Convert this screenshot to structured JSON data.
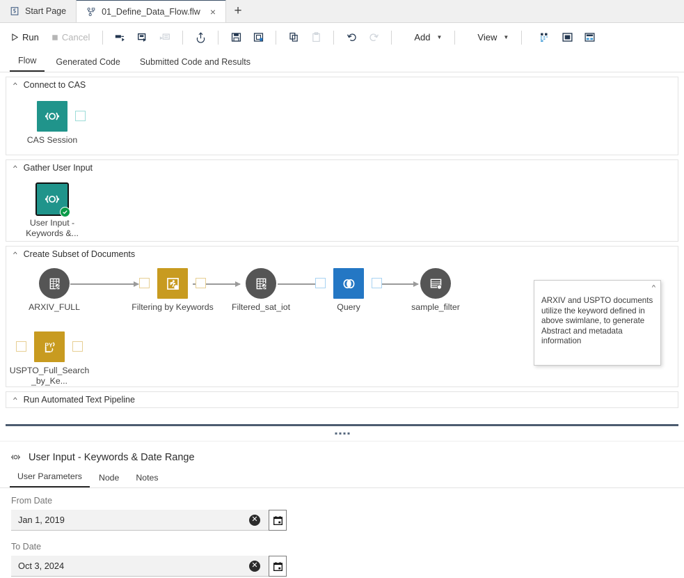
{
  "tabs": {
    "start_page": {
      "label": "Start Page",
      "icon": "sas-logo-icon"
    },
    "flow_tab": {
      "label": "01_Define_Data_Flow.flw",
      "icon": "flow-icon",
      "close": "×"
    },
    "new_tab": "+"
  },
  "toolbar": {
    "run": "Run",
    "cancel": "Cancel",
    "run_icon": "play-icon",
    "cancel_icon": "stop-icon",
    "icons": [
      {
        "name": "run-from-node-icon",
        "enabled": true
      },
      {
        "name": "run-selected-node-icon",
        "enabled": true
      },
      {
        "name": "run-to-node-icon",
        "enabled": false
      },
      {
        "name": "upload-icon",
        "enabled": true
      },
      {
        "name": "save-icon",
        "enabled": true
      },
      {
        "name": "save-as-icon",
        "enabled": true
      },
      {
        "name": "copy-icon",
        "enabled": true
      },
      {
        "name": "paste-icon",
        "enabled": false
      },
      {
        "name": "undo-icon",
        "enabled": true
      },
      {
        "name": "redo-icon",
        "enabled": false
      }
    ],
    "add": "Add",
    "view": "View",
    "right_icons": [
      {
        "name": "layout-options-icon"
      },
      {
        "name": "show-properties-icon"
      },
      {
        "name": "split-view-icon"
      }
    ]
  },
  "view_tabs": [
    {
      "label": "Flow",
      "active": true
    },
    {
      "label": "Generated Code",
      "active": false
    },
    {
      "label": "Submitted Code and Results",
      "active": false
    }
  ],
  "canvas": {
    "lanes": [
      {
        "title": "Connect to CAS"
      },
      {
        "title": "Gather User Input"
      },
      {
        "title": "Create Subset of Documents"
      },
      {
        "title": "Run Automated Text Pipeline"
      }
    ],
    "nodes": {
      "cas_session": {
        "label": "CAS Session",
        "icon": "cas-session-icon",
        "color": "#20948b"
      },
      "user_input": {
        "label": "User Input - Keywords &...",
        "icon": "cas-session-icon",
        "color": "#20948b",
        "status": "success-check-icon"
      },
      "arxiv_full": {
        "label": "ARXIV_FULL",
        "icon": "table-icon",
        "color": "#555555"
      },
      "filtering": {
        "label": "Filtering by Keywords",
        "icon": "runner-icon",
        "color": "#c89b20"
      },
      "filtered_sat": {
        "label": "Filtered_sat_iot",
        "icon": "table-icon",
        "color": "#555555"
      },
      "query": {
        "label": "Query",
        "icon": "venn-query-icon",
        "color": "#2477c4"
      },
      "sample_filter": {
        "label": "sample_filter",
        "icon": "table-filter-icon",
        "color": "#555555"
      },
      "uspto": {
        "label": "USPTO_Full_Search_by_Ke...",
        "icon": "python-icon",
        "color": "#c89b20"
      }
    },
    "annotation": {
      "text": "ARXIV and USPTO documents utilize the keyword defined in above swimlane, to generate Abstract and metadata information",
      "collapse_icon": "chevron-up-icon"
    }
  },
  "properties": {
    "title": "User Input - Keywords & Date Range",
    "title_icon": "cas-session-icon",
    "tabs": [
      {
        "label": "User Parameters",
        "active": true
      },
      {
        "label": "Node",
        "active": false
      },
      {
        "label": "Notes",
        "active": false
      }
    ],
    "fields": [
      {
        "label": "From Date",
        "value": "Jan 1, 2019",
        "clear_icon": "clear-icon",
        "picker_icon": "calendar-icon"
      },
      {
        "label": "To Date",
        "value": "Oct 3, 2024",
        "clear_icon": "clear-icon",
        "picker_icon": "calendar-icon"
      }
    ]
  }
}
